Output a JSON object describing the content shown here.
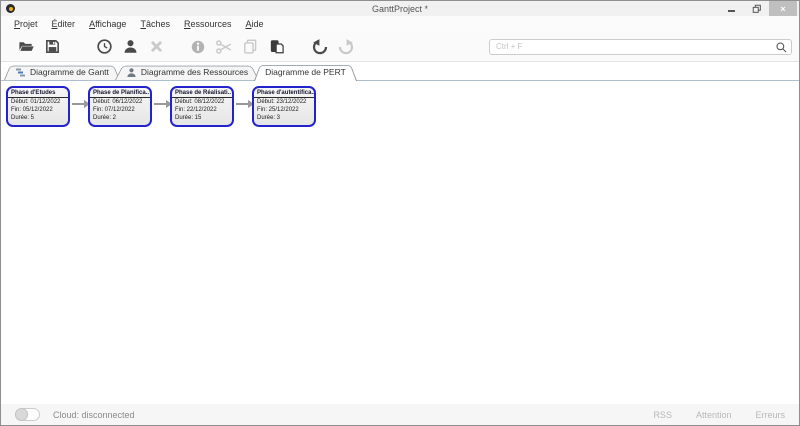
{
  "window": {
    "title": "GanttProject *",
    "close_glyph": "×"
  },
  "menu": {
    "items": [
      "Projet",
      "Éditer",
      "Affichage",
      "Tâches",
      "Ressources",
      "Aide"
    ]
  },
  "toolbar": {
    "search_placeholder": "Ctrl + F",
    "icons": [
      "open-project",
      "save-project",
      "time-clock",
      "new-resource",
      "delete",
      "properties-info",
      "cut-scissors",
      "copy",
      "paste",
      "undo",
      "redo",
      "search-magnifier"
    ]
  },
  "tabs": {
    "gantt": "Diagramme de Gantt",
    "resources": "Diagramme des Ressources",
    "pert": "Diagramme de PERT"
  },
  "pert": {
    "nodes": [
      {
        "title": "Phase d'Etudes",
        "start": "Début: 01/12/2022",
        "end": "Fin: 05/12/2022",
        "duration": "Durée: 5"
      },
      {
        "title": "Phase de Planifica..",
        "start": "Début: 06/12/2022",
        "end": "Fin: 07/12/2022",
        "duration": "Durée: 2"
      },
      {
        "title": "Phase de Réalisati..",
        "start": "Début: 08/12/2022",
        "end": "Fin: 22/12/2022",
        "duration": "Durée: 15"
      },
      {
        "title": "Phase d'autentifica..",
        "start": "Début: 23/12/2022",
        "end": "Fin: 25/12/2022",
        "duration": "Durée: 3"
      }
    ]
  },
  "statusbar": {
    "cloud": "Cloud: disconnected",
    "rss": "RSS",
    "attention": "Attention",
    "errors": "Erreurs"
  },
  "colors": {
    "accent_blue": "#2323cd",
    "icon_enabled": "#4a4a4a",
    "icon_disabled": "#c9c9c9"
  }
}
